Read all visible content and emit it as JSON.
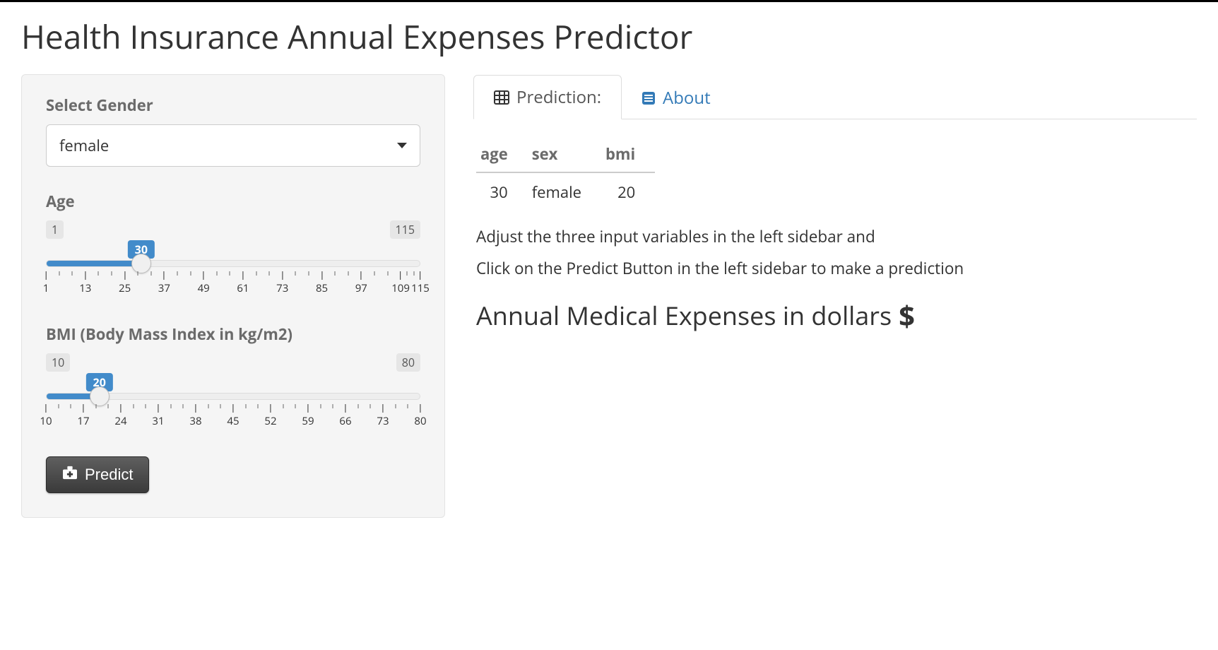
{
  "title": "Health Insurance Annual Expenses Predictor",
  "sidebar": {
    "gender": {
      "label": "Select Gender",
      "value": "female"
    },
    "age": {
      "label": "Age",
      "min": 1,
      "max": 115,
      "value": 30,
      "major_ticks": [
        1,
        13,
        25,
        37,
        49,
        61,
        73,
        85,
        97,
        109,
        115
      ]
    },
    "bmi": {
      "label": "BMI (Body Mass Index in kg/m2)",
      "min": 10,
      "max": 80,
      "value": 20,
      "major_ticks": [
        10,
        17,
        24,
        31,
        38,
        45,
        52,
        59,
        66,
        73,
        80
      ]
    },
    "predict_label": "Predict"
  },
  "tabs": {
    "prediction": "Prediction:",
    "about": "About"
  },
  "table": {
    "headers": {
      "age": "age",
      "sex": "sex",
      "bmi": "bmi"
    },
    "row": {
      "age": "30",
      "sex": "female",
      "bmi": "20"
    }
  },
  "instructions": {
    "line1": "Adjust the three input variables in the left sidebar and",
    "line2": "Click on the Predict Button in the left sidebar to make a prediction"
  },
  "result_heading": "Annual Medical Expenses in dollars"
}
